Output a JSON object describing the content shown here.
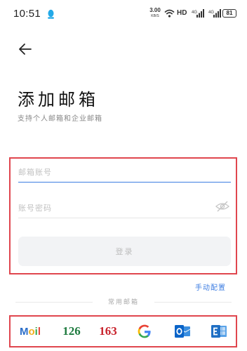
{
  "status_bar": {
    "time": "10:51",
    "net_speed_value": "3.00",
    "net_speed_unit": "KB/S",
    "hd_label": "HD",
    "battery": "81",
    "icons": [
      "qq-icon",
      "wifi-icon",
      "signal-icon",
      "signal-icon",
      "battery-icon"
    ]
  },
  "header": {
    "back_icon": "arrow-left-icon"
  },
  "page": {
    "title": "添加邮箱",
    "subtitle": "支持个人邮箱和企业邮箱"
  },
  "form": {
    "email_placeholder": "邮箱账号",
    "email_value": "",
    "password_placeholder": "账号密码",
    "password_value": "",
    "password_toggle_icon": "eye-off-icon",
    "login_label": "登录"
  },
  "manual_config_label": "手动配置",
  "common_mailboxes_label": "常用邮箱",
  "providers": [
    {
      "id": "mail",
      "label": "Mail"
    },
    {
      "id": "126",
      "label": "126"
    },
    {
      "id": "163",
      "label": "163"
    },
    {
      "id": "google",
      "label": "G"
    },
    {
      "id": "outlook",
      "label": "O"
    },
    {
      "id": "exchange",
      "label": "E"
    }
  ],
  "colors": {
    "accent_blue": "#3d7de2",
    "highlight_red": "#e0464e",
    "provider_126": "#1d7a3e",
    "provider_163": "#c8222c",
    "outlook_blue": "#0a64c8"
  }
}
